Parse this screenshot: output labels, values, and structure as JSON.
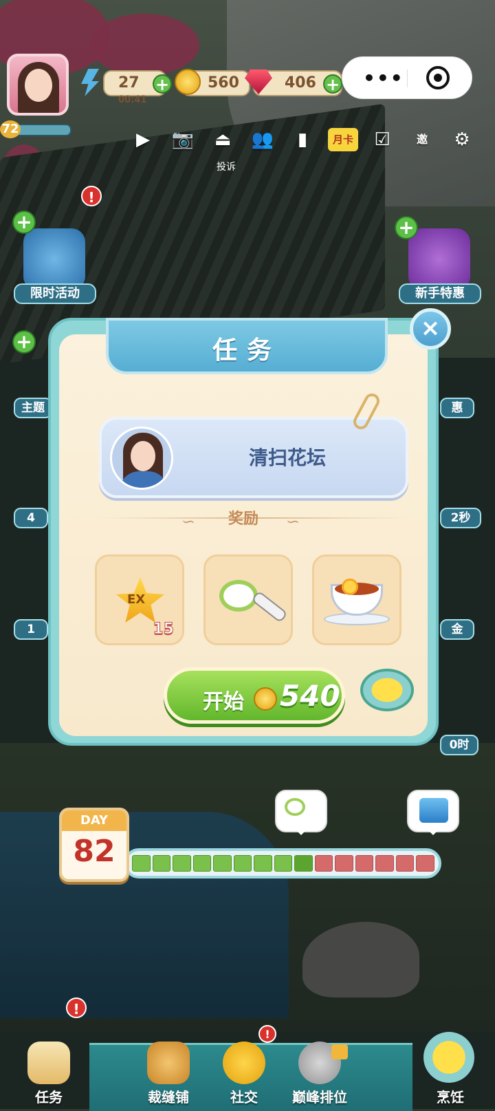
{
  "hud": {
    "level": "72",
    "energy": "27",
    "energy_timer": "00:41",
    "coins": "560",
    "gems": "406",
    "plus": "+"
  },
  "mini_program": {
    "more": "•••"
  },
  "toolbar": {
    "items": [
      "play-icon",
      "camera-icon",
      "report-icon",
      "friends-icon",
      "book-icon",
      "month-card",
      "checkin-icon",
      "invite-icon",
      "settings-icon"
    ],
    "month_card_label": "月卡",
    "invite_label": "邀",
    "report_caption": "投诉"
  },
  "side": {
    "left_top_label": "限时活动",
    "left_mid_label": "主题",
    "left_timer_1": "4",
    "left_timer_2": "1",
    "right_top_label": "新手特惠",
    "right_peek_1": "惠",
    "right_peek_2": "2秒",
    "right_peek_3": "金",
    "right_peek_4": "0时"
  },
  "modal": {
    "title": "任务",
    "close": "×",
    "task_name": "清扫花坛",
    "rewards_label": "奖励",
    "rewards": [
      {
        "name": "EX",
        "count": "15"
      },
      {
        "name": "strainer",
        "count": ""
      },
      {
        "name": "lemon-tea",
        "count": ""
      }
    ],
    "start_label": "开始",
    "start_cost": "540"
  },
  "day": {
    "label": "DAY",
    "number": "82",
    "segments_total": 15,
    "segments_done": 9
  },
  "nav": {
    "tasks": "任务",
    "tailor": "裁缝铺",
    "social": "社交",
    "ranking": "巅峰排位",
    "cooking": "烹饪",
    "alert": "!"
  },
  "colors": {
    "accent_green": "#62b72c",
    "modal_teal": "#8fd6d6",
    "header_blue": "#56aed3",
    "progress_done": "#79c14a",
    "progress_todo": "#d46a6a"
  }
}
